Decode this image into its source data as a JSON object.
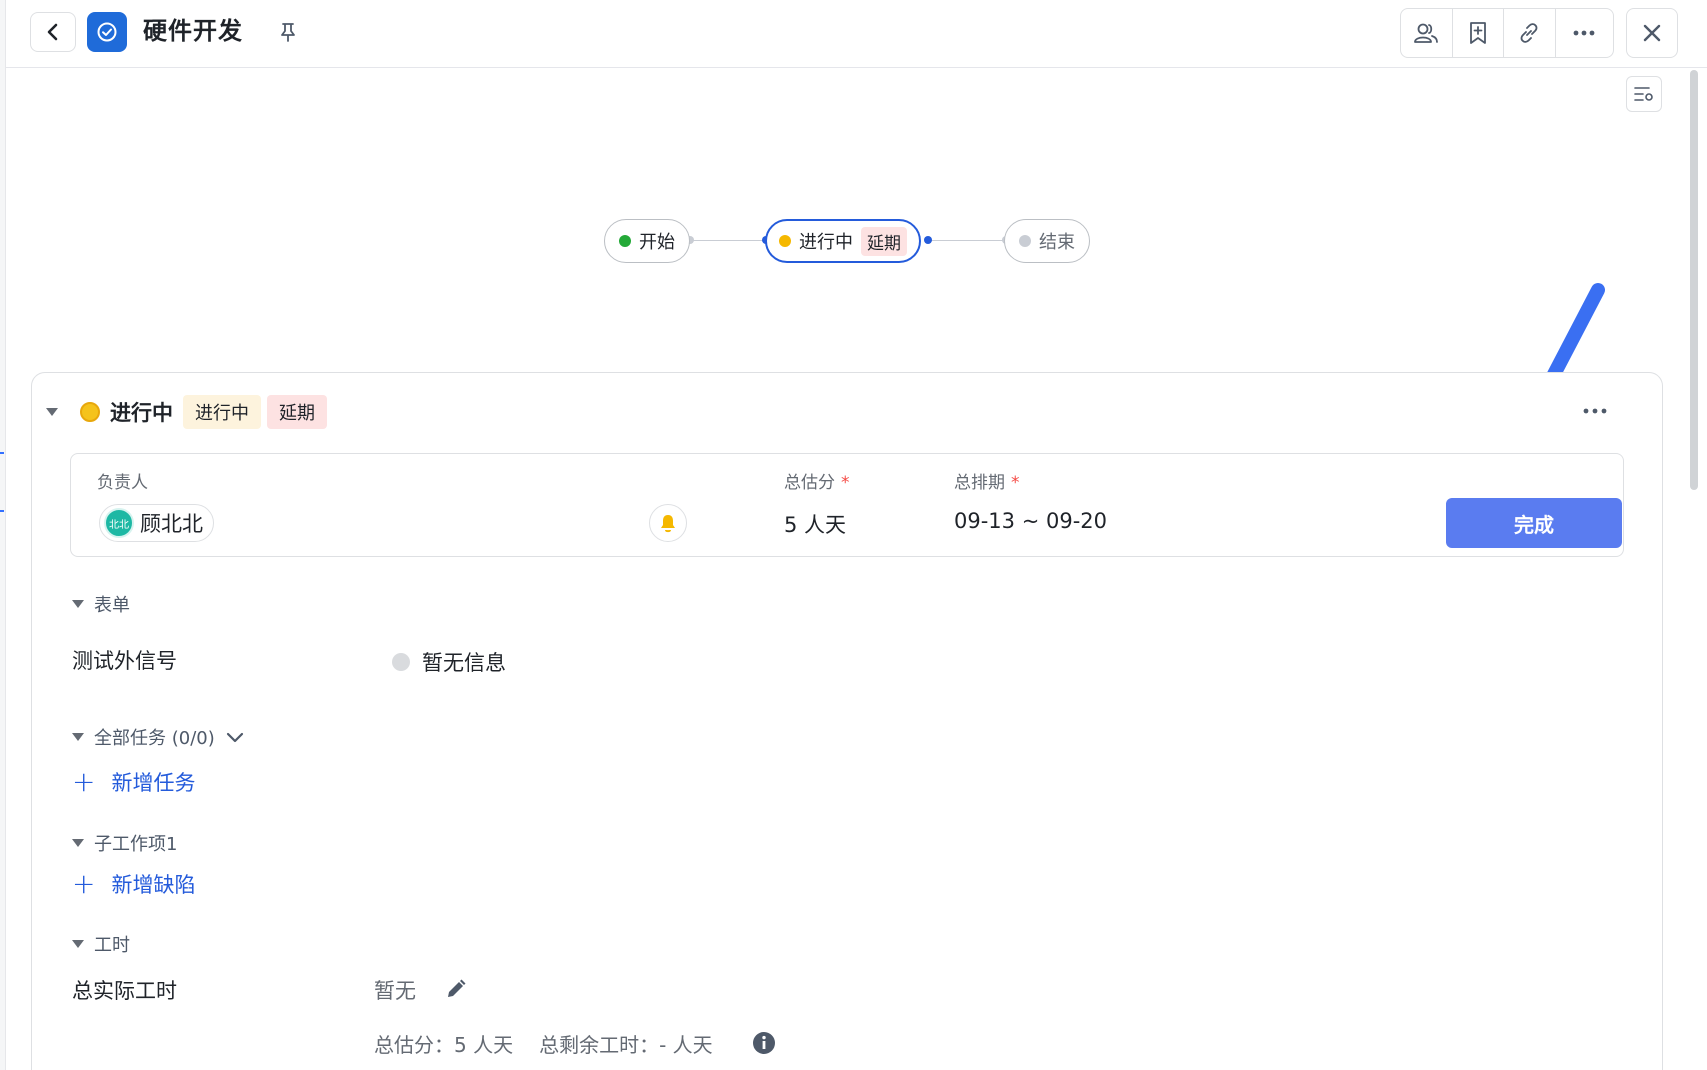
{
  "header": {
    "title": "硬件开发"
  },
  "workflow": {
    "nodes": [
      {
        "label": "开始",
        "color": "#24a938"
      },
      {
        "label": "进行中",
        "color": "#f5b800",
        "tag": "延期"
      },
      {
        "label": "结束",
        "color": "#c9cdd4"
      }
    ]
  },
  "card": {
    "title": "进行中",
    "status_tag": "进行中",
    "delay_tag": "延期",
    "owner_label": "负责人",
    "owner_avatar_text": "北北",
    "owner_name": "顾北北",
    "estimate_label": "总估分",
    "estimate_value": "5 人天",
    "schedule_label": "总排期",
    "schedule_value": "09-13 ~ 09-20",
    "required_mark": "*",
    "done_button": "完成"
  },
  "form": {
    "section_label": "表单",
    "field_label": "测试外信号",
    "field_value": "暂无信息"
  },
  "tasks": {
    "section_label": "全部任务 (0/0)",
    "add_label": "新增任务"
  },
  "subitems": {
    "section_label": "子工作项1",
    "add_label": "新增缺陷"
  },
  "worktime": {
    "section_label": "工时",
    "actual_label": "总实际工时",
    "actual_value": "暂无",
    "estimate_text": "总估分：5 人天",
    "remaining_text": "总剩余工时：- 人天"
  },
  "colors": {
    "accent": "#245bdb",
    "done_button": "#5a7cf0",
    "arrow": "#3a6ff2"
  }
}
